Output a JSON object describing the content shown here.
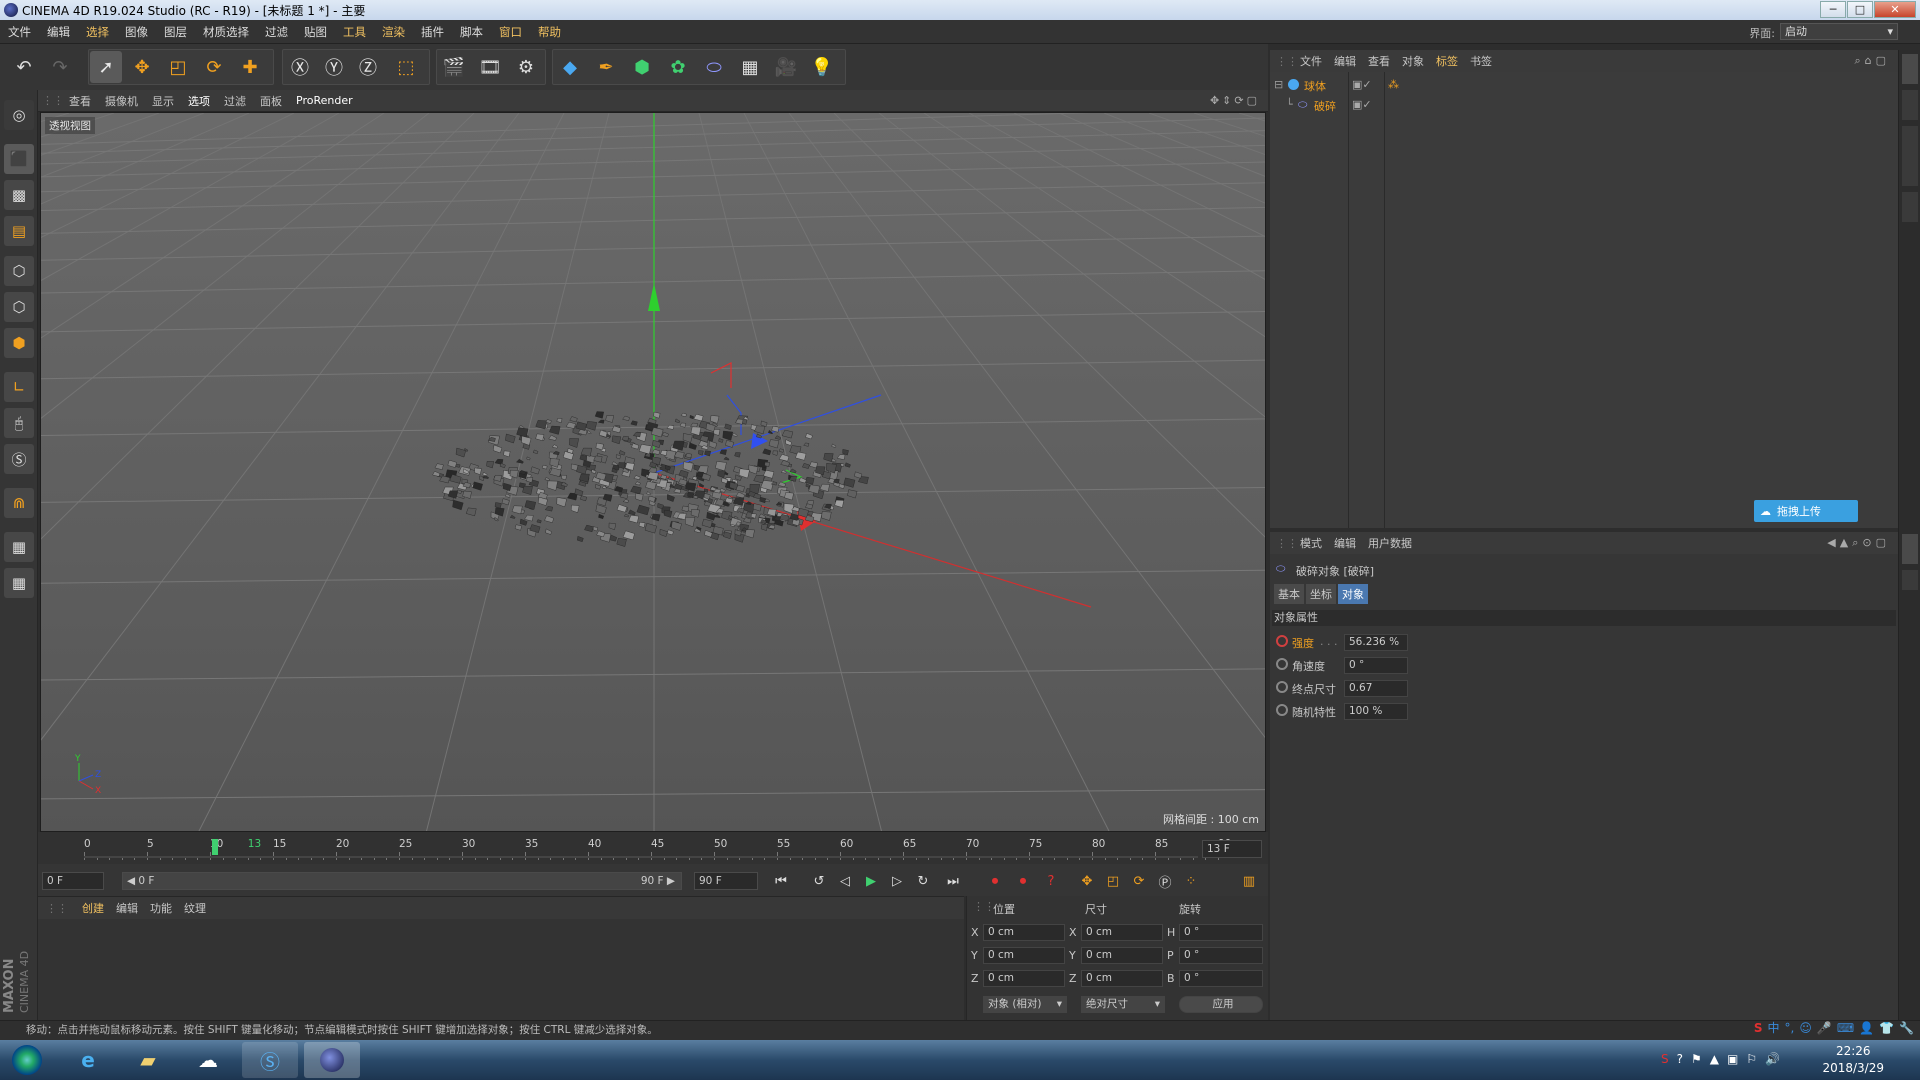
{
  "window": {
    "title": "CINEMA 4D R19.024 Studio (RC - R19) - [未标题 1 *] - 主要",
    "min": "─",
    "max": "□",
    "close": "✕"
  },
  "menubar": {
    "items": [
      "文件",
      "编辑",
      "选择",
      "图像",
      "图层",
      "材质选择",
      "过滤",
      "贴图",
      "工具",
      "渲染",
      "插件",
      "脚本",
      "窗口",
      "帮助"
    ],
    "layout_label": "界面:",
    "layout_value": "启动"
  },
  "viewport": {
    "menu": [
      "查看",
      "摄像机",
      "显示",
      "选项",
      "过滤",
      "面板",
      "ProRender"
    ],
    "view_name": "透视视图",
    "grid_distance": "网格间距 : 100 cm",
    "mini_axis": {
      "y": "Y",
      "z": "Z",
      "x": "X"
    }
  },
  "timeline": {
    "ticks": [
      "0",
      "5",
      "10",
      "13",
      "15",
      "20",
      "25",
      "30",
      "35",
      "40",
      "45",
      "50",
      "55",
      "60",
      "65",
      "70",
      "75",
      "80",
      "85",
      "90"
    ],
    "current_frame_field": "13 F",
    "start_field": "0 F",
    "range_start": "◀ 0 F",
    "range_end": "90 F ▶",
    "end_field": "90 F"
  },
  "materials": {
    "menu": [
      "创建",
      "编辑",
      "功能",
      "纹理"
    ]
  },
  "coords": {
    "headers": {
      "position": "位置",
      "size": "尺寸",
      "rotation": "旋转"
    },
    "rows": [
      {
        "pl": "X",
        "pv": "0 cm",
        "sl": "X",
        "sv": "0 cm",
        "rl": "H",
        "rv": "0 °"
      },
      {
        "pl": "Y",
        "pv": "0 cm",
        "sl": "Y",
        "sv": "0 cm",
        "rl": "P",
        "rv": "0 °"
      },
      {
        "pl": "Z",
        "pv": "0 cm",
        "sl": "Z",
        "sv": "0 cm",
        "rl": "B",
        "rv": "0 °"
      }
    ],
    "mode_select": "对象 (相对)",
    "size_select": "绝对尺寸",
    "apply": "应用"
  },
  "object_manager": {
    "menu": [
      "文件",
      "编辑",
      "查看",
      "对象",
      "标签",
      "书签"
    ],
    "objects": [
      {
        "name": "球体"
      },
      {
        "name": "破碎"
      }
    ],
    "upload_button": "拖拽上传"
  },
  "attributes": {
    "menu": [
      "模式",
      "编辑",
      "用户数据"
    ],
    "object_title": "破碎对象 [破碎]",
    "tabs": [
      "基本",
      "坐标",
      "对象"
    ],
    "section": "对象属性",
    "params": [
      {
        "label": "强度",
        "dots": ". . .",
        "value": "56.236 %"
      },
      {
        "label": "角速度",
        "dots": "",
        "value": "0 °"
      },
      {
        "label": "终点尺寸",
        "dots": "",
        "value": "0.67"
      },
      {
        "label": "随机特性",
        "dots": "",
        "value": "100 %"
      }
    ]
  },
  "status": "移动：点击并拖动鼠标移动元素。按住 SHIFT 键量化移动；节点编辑模式时按住 SHIFT 键增加选择对象；按住 CTRL 键减少选择对象。",
  "brand": {
    "maxon": "MAXON",
    "product": "CINEMA 4D"
  },
  "taskbar": {
    "time": "22:26",
    "date": "2018/3/29",
    "ime": "中"
  },
  "colors": {
    "accent": "#f0c060",
    "x_axis": "#e03030",
    "y_axis": "#30c030",
    "z_axis": "#3050e0",
    "playhead": "#40d070"
  }
}
